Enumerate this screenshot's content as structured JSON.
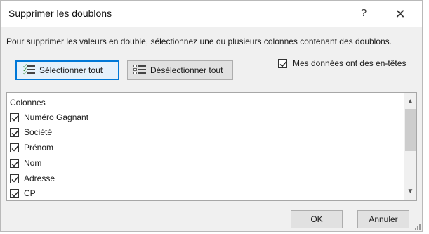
{
  "dialog": {
    "title": "Supprimer les doublons",
    "help_glyph": "?",
    "close_glyph": "✕",
    "instruction": "Pour supprimer les valeurs en double, sélectionnez une ou plusieurs colonnes contenant des doublons."
  },
  "toolbar": {
    "select_all": {
      "mnemonic": "S",
      "rest": "électionner tout"
    },
    "deselect_all": {
      "mnemonic": "D",
      "rest": "ésélectionner tout"
    },
    "has_headers": {
      "mnemonic": "M",
      "rest": "es données ont des en-têtes",
      "checked": true
    }
  },
  "columns": {
    "header": "Colonnes",
    "items": [
      {
        "label": "Numéro Gagnant",
        "checked": true
      },
      {
        "label": "Société",
        "checked": true
      },
      {
        "label": "Prénom",
        "checked": true
      },
      {
        "label": "Nom",
        "checked": true
      },
      {
        "label": "Adresse",
        "checked": true
      },
      {
        "label": "CP",
        "checked": true
      }
    ],
    "scroll_up_glyph": "▲",
    "scroll_down_glyph": "▼"
  },
  "actions": {
    "ok": "OK",
    "cancel": "Annuler"
  },
  "colors": {
    "accent": "#0078d7",
    "select_icon_check": "#2e8b2e"
  }
}
